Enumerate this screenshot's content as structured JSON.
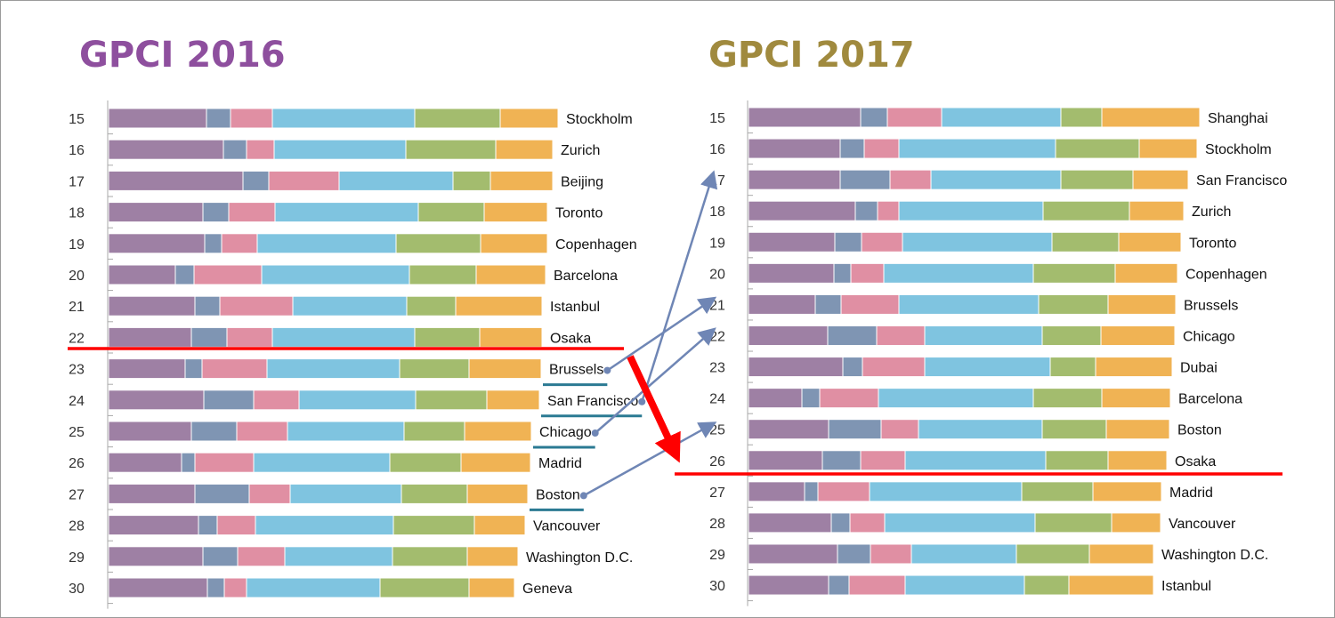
{
  "chart_data": [
    {
      "type": "bar",
      "orientation": "horizontal",
      "stacked": true,
      "title": "GPCI 2016",
      "title_color": "#8e4f9e",
      "segment_colors": [
        "#9e80a4",
        "#7f95b3",
        "#e08fa3",
        "#7fc4e0",
        "#a3bc6e",
        "#f0b354"
      ],
      "value_units": "relative (no axis printed)",
      "rows": [
        {
          "rank": "15",
          "city": "Stockholm",
          "values": [
            110,
            27,
            47,
            160,
            96,
            65
          ]
        },
        {
          "rank": "16",
          "city": "Zurich",
          "values": [
            129,
            26,
            31,
            148,
            101,
            64
          ]
        },
        {
          "rank": "17",
          "city": "Beijing",
          "values": [
            151,
            29,
            79,
            128,
            42,
            70
          ]
        },
        {
          "rank": "18",
          "city": "Toronto",
          "values": [
            106,
            29,
            52,
            161,
            74,
            71
          ]
        },
        {
          "rank": "19",
          "city": "Copenhagen",
          "values": [
            108,
            19,
            40,
            156,
            95,
            75
          ]
        },
        {
          "rank": "20",
          "city": "Barcelona",
          "values": [
            75,
            21,
            76,
            166,
            75,
            78
          ]
        },
        {
          "rank": "21",
          "city": "Istanbul",
          "values": [
            97,
            28,
            82,
            128,
            55,
            97
          ]
        },
        {
          "rank": "22",
          "city": "Osaka",
          "values": [
            93,
            40,
            51,
            160,
            73,
            70
          ]
        },
        {
          "rank": "23",
          "city": "Brussels",
          "values": [
            86,
            19,
            73,
            149,
            78,
            81
          ],
          "highlight": true
        },
        {
          "rank": "24",
          "city": "San Francisco",
          "values": [
            107,
            56,
            51,
            131,
            80,
            59
          ],
          "highlight": true
        },
        {
          "rank": "25",
          "city": "Chicago",
          "values": [
            93,
            51,
            57,
            131,
            68,
            75
          ],
          "highlight": true
        },
        {
          "rank": "26",
          "city": "Madrid",
          "values": [
            82,
            15,
            66,
            153,
            80,
            78
          ]
        },
        {
          "rank": "27",
          "city": "Boston",
          "values": [
            97,
            61,
            46,
            125,
            74,
            68
          ],
          "highlight": true
        },
        {
          "rank": "28",
          "city": "Vancouver",
          "values": [
            101,
            21,
            43,
            155,
            91,
            57
          ]
        },
        {
          "rank": "29",
          "city": "Washington D.C.",
          "values": [
            106,
            39,
            53,
            121,
            84,
            57
          ]
        },
        {
          "rank": "30",
          "city": "Geneva",
          "values": [
            111,
            19,
            25,
            150,
            100,
            51
          ]
        }
      ],
      "cutoff_after_rank": "22"
    },
    {
      "type": "bar",
      "orientation": "horizontal",
      "stacked": true,
      "title": "GPCI 2017",
      "title_color": "#a08a3e",
      "segment_colors": [
        "#9e80a4",
        "#7f95b3",
        "#e08fa3",
        "#7fc4e0",
        "#a3bc6e",
        "#f0b354"
      ],
      "value_units": "relative (no axis printed)",
      "rows": [
        {
          "rank": "15",
          "city": "Shanghai",
          "values": [
            126,
            30,
            61,
            134,
            46,
            110
          ]
        },
        {
          "rank": "16",
          "city": "Stockholm",
          "values": [
            103,
            27,
            39,
            176,
            94,
            65
          ]
        },
        {
          "rank": "17",
          "city": "San Francisco",
          "values": [
            103,
            56,
            46,
            146,
            81,
            62
          ]
        },
        {
          "rank": "18",
          "city": "Zurich",
          "values": [
            120,
            25,
            24,
            162,
            97,
            61
          ]
        },
        {
          "rank": "19",
          "city": "Toronto",
          "values": [
            97,
            30,
            46,
            168,
            75,
            70
          ]
        },
        {
          "rank": "20",
          "city": "Copenhagen",
          "values": [
            96,
            19,
            37,
            168,
            92,
            70
          ]
        },
        {
          "rank": "21",
          "city": "Brussels",
          "values": [
            75,
            29,
            65,
            157,
            78,
            76
          ]
        },
        {
          "rank": "22",
          "city": "Chicago",
          "values": [
            89,
            55,
            54,
            132,
            66,
            83
          ]
        },
        {
          "rank": "23",
          "city": "Dubai",
          "values": [
            106,
            22,
            70,
            141,
            51,
            86
          ]
        },
        {
          "rank": "24",
          "city": "Barcelona",
          "values": [
            60,
            20,
            66,
            174,
            77,
            77
          ]
        },
        {
          "rank": "25",
          "city": "Boston",
          "values": [
            90,
            59,
            42,
            139,
            72,
            71
          ]
        },
        {
          "rank": "26",
          "city": "Osaka",
          "values": [
            83,
            43,
            50,
            158,
            70,
            66
          ]
        },
        {
          "rank": "27",
          "city": "Madrid",
          "values": [
            63,
            15,
            58,
            171,
            80,
            77
          ]
        },
        {
          "rank": "28",
          "city": "Vancouver",
          "values": [
            93,
            21,
            39,
            169,
            86,
            55
          ]
        },
        {
          "rank": "29",
          "city": "Washington D.C.",
          "values": [
            100,
            37,
            46,
            118,
            82,
            72
          ]
        },
        {
          "rank": "30",
          "city": "Istanbul",
          "values": [
            90,
            23,
            63,
            134,
            50,
            95
          ]
        }
      ],
      "cutoff_after_rank": "26"
    }
  ],
  "annotations": {
    "moves": [
      {
        "city": "Brussels",
        "from_rank": "23",
        "to_rank": "21"
      },
      {
        "city": "San Francisco",
        "from_rank": "24",
        "to_rank": "17"
      },
      {
        "city": "Chicago",
        "from_rank": "25",
        "to_rank": "22"
      },
      {
        "city": "Boston",
        "from_rank": "27",
        "to_rank": "25"
      }
    ],
    "move_arrow_color": "#6f86b5",
    "cutoff_line_color": "#ff0000",
    "underline_color": "#2b7a93"
  }
}
